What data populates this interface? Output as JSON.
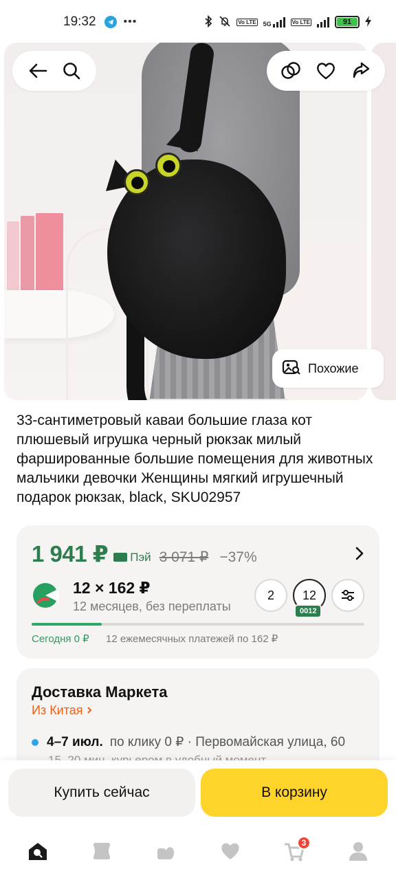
{
  "status_bar": {
    "time": "19:32",
    "dots": "•••",
    "network": "5G",
    "volte_1": "Vo LTE",
    "volte_2": "Vo LTE",
    "battery": "91"
  },
  "hero": {
    "similar_label": "Похожие"
  },
  "product": {
    "title": "33-сантиметровый каваи большие глаза кот плюшевый игрушка черный рюкзак милый фаршированные большие помещения для животных мальчики девочки Женщины мягкий игрушечный подарок рюкзак, black, SKU02957"
  },
  "price": {
    "current": "1 941 ₽",
    "pay_label": "Пэй",
    "old": "3 071 ₽",
    "discount": "−37%"
  },
  "split": {
    "main": "12 × 162 ₽",
    "sub": "12 месяцев, без переплаты",
    "terms": [
      "2",
      "12"
    ],
    "active_term_tag": "0012",
    "progress_fraction": 0.21,
    "today": "Сегодня 0 ₽",
    "schedule": "12 ежемесячных платежей по 162 ₽"
  },
  "delivery": {
    "title": "Доставка Маркета",
    "from": "Из Китая",
    "dates": "4–7 июл.",
    "details": "по клику 0 ₽ · Первомайская улица, 60",
    "extra": "15–20 мин, курьером в удобный момент"
  },
  "actions": {
    "buy_now": "Купить сейчас",
    "to_cart": "В корзину"
  },
  "nav": {
    "cart_count": "3"
  },
  "colors": {
    "price_green": "#2e7d4f",
    "cart_yellow": "#fed42b",
    "link_orange": "#e8631b",
    "badge_red": "#f04438"
  },
  "icons": [
    "back-arrow-icon",
    "search-icon",
    "compare-icon",
    "heart-icon",
    "share-icon",
    "image-search-icon",
    "chevron-right-icon",
    "filter-settings-icon",
    "home-icon",
    "catalog-icon",
    "fresh-food-icon",
    "favorites-icon",
    "cart-icon",
    "profile-icon"
  ]
}
